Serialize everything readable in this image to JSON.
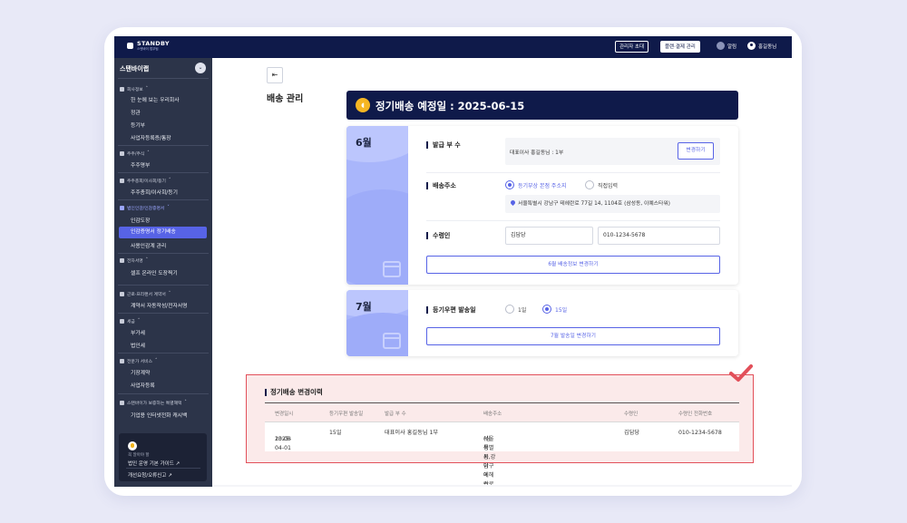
{
  "topbar": {
    "logo_text": "STANDBY",
    "logo_sub": "스탠바이 법무팀",
    "invite_admin": "관리자 초대",
    "billing": "플랜·결제 관리",
    "alarm": "알림",
    "user": "홍길동님"
  },
  "sidebar": {
    "company": "스탠바이랩",
    "groups": [
      {
        "title": "회사정보",
        "items": [
          "한 눈에 보는 우리회사",
          "정관",
          "등기부",
          "사업자등록증/통장"
        ]
      },
      {
        "title": "주주/주식",
        "items": [
          "주주명부"
        ]
      },
      {
        "title": "주주총회/이사회/등기",
        "items": [
          "주주총회/이사회/등기"
        ]
      },
      {
        "title": "법인인감/인감증명서",
        "items": [
          "인감도장",
          "인감증명서 정기배송",
          "사용인감계 관리"
        ]
      },
      {
        "title": "전자서명",
        "items": [
          "셀프 온라인 도장찍기"
        ]
      },
      {
        "title": "근로·프리랜서 계약서",
        "items": [
          "계약서 자동작성/전자서명"
        ]
      },
      {
        "title": "세금",
        "items": [
          "부가세",
          "법인세"
        ]
      },
      {
        "title": "전문가 서비스",
        "items": [
          "기장계약",
          "사업자등록"
        ]
      },
      {
        "title": "스탠바이가 보증하는 특별혜택",
        "items": [
          "기업용 인터넷전화 캐시백"
        ]
      }
    ],
    "card": {
      "tip": "꼭 알아야 할",
      "guide": "법인 운영 기본 가이드",
      "feedback": "개선요청/오류신고"
    }
  },
  "main": {
    "back_icon": "exit-icon",
    "title": "배송 관리",
    "banner": "정기배송 예정일 : 2025-06-15",
    "june": {
      "month": "6월",
      "copies_label": "발급 부 수",
      "copies_value": "대표이사 홍길동님 : 1부",
      "change_btn": "변경하기",
      "address_label": "배송주소",
      "radio_registered": "등기부상 본점 주소지",
      "radio_direct": "직접입력",
      "address": "서울특별시 강남구 테헤란로 77길 14, 1104호 (삼성동, 이예스타워)",
      "recipient_label": "수령인",
      "recipient_name": "김담당",
      "recipient_phone": "010-1234-5678",
      "save_btn": "6월 배송정보 변경하기"
    },
    "july": {
      "month": "7월",
      "date_label": "등기우편 발송일",
      "opt1": "1일",
      "opt15": "15일",
      "save_btn": "7월 발송일 변경하기"
    },
    "history": {
      "title": "정기배송 변경이력",
      "headers": [
        "변경일시",
        "등기우편 발송일",
        "발급 부 수",
        "배송주소",
        "수령인",
        "수령인 전화번호"
      ],
      "row": {
        "date": "2025-04-01",
        "time": "13:08",
        "send_day": "15일",
        "copies": "대표이사 홍길동님 1부",
        "addr1": "서울특별시 강남구 테헤란로 77길 14, 1104호",
        "addr2": "(삼성동, 이예스타워)",
        "recipient": "김담당",
        "phone": "010-1234-5678"
      }
    }
  },
  "colors": {
    "navy": "#0f1a4a",
    "accent": "#5763e6",
    "highlight_border": "#e2505a",
    "month_panel": "#a9b6fb"
  }
}
